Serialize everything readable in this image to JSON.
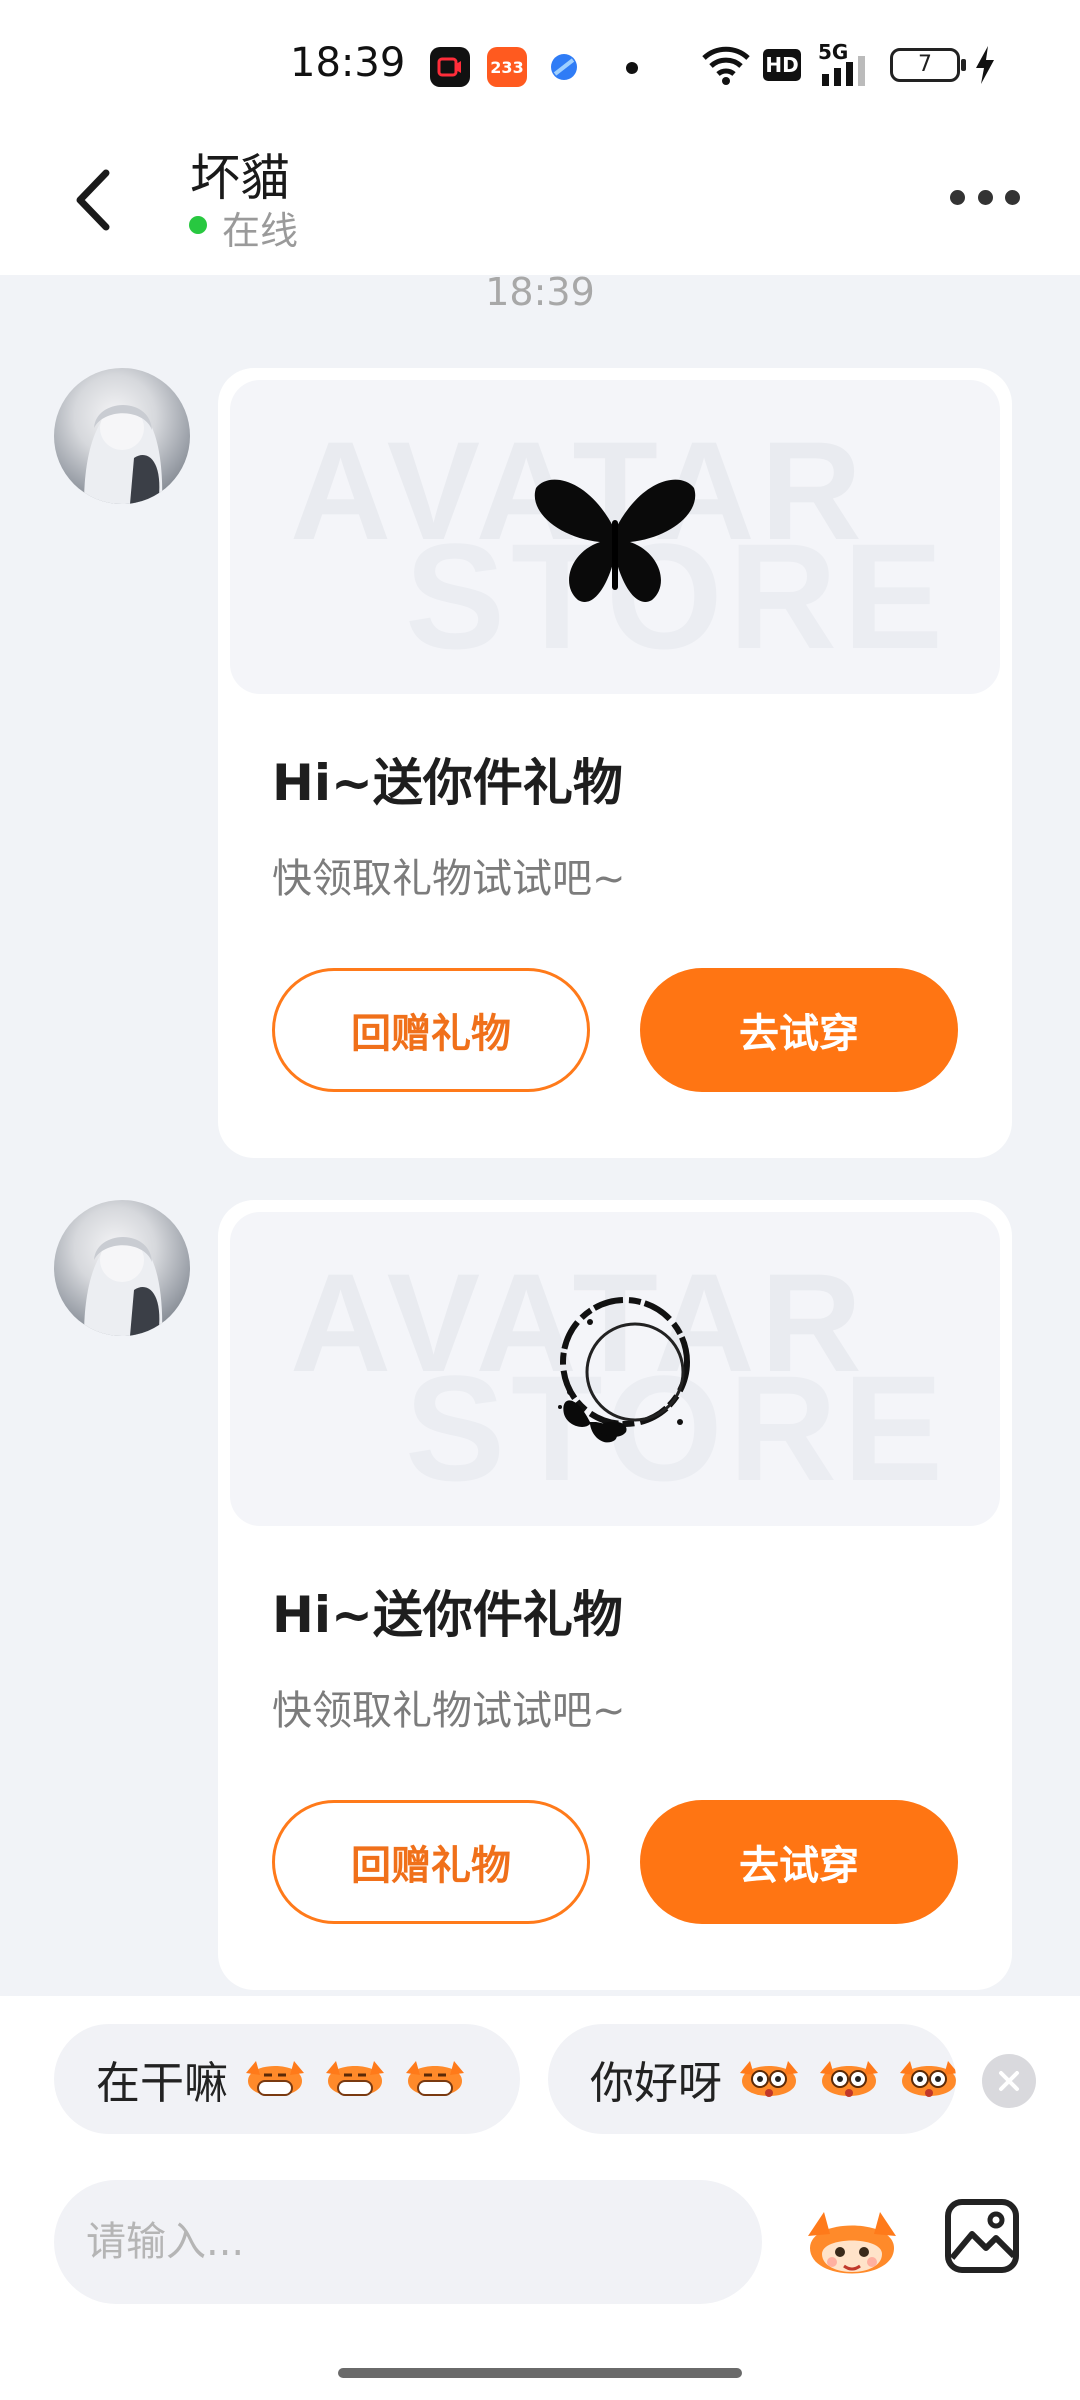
{
  "status_bar": {
    "time": "18:39",
    "app_badges": [
      "233"
    ],
    "network": "5G",
    "hd": "HD",
    "battery": "7"
  },
  "header": {
    "title": "坏貓",
    "presence": "在线",
    "back_icon": "chevron-left-icon",
    "more_icon": "more-horizontal-icon"
  },
  "chat": {
    "timestamp": "18:39",
    "messages": [
      {
        "image": "butterfly",
        "watermark_line1": "AVATAR",
        "watermark_line2": "STORE",
        "title": "Hi~送你件礼物",
        "subtitle": "快领取礼物试试吧~",
        "secondary_button": "回赠礼物",
        "primary_button": "去试穿"
      },
      {
        "image": "moon-butterfly",
        "watermark_line1": "AVATAR",
        "watermark_line2": "STORE",
        "title": "Hi~送你件礼物",
        "subtitle": "快领取礼物试试吧~",
        "secondary_button": "回赠礼物",
        "primary_button": "去试穿"
      }
    ]
  },
  "quick_replies": [
    {
      "text": "在干嘛",
      "emoji": "grinning-mascot-icon"
    },
    {
      "text": "你好呀",
      "emoji": "surprised-mascot-icon"
    }
  ],
  "composer": {
    "placeholder": "请输入...",
    "emoji_icon": "mascot-emoji-icon",
    "image_icon": "image-icon"
  },
  "colors": {
    "accent": "#ff7513",
    "online": "#28c840",
    "background": "#f1f3f7"
  }
}
